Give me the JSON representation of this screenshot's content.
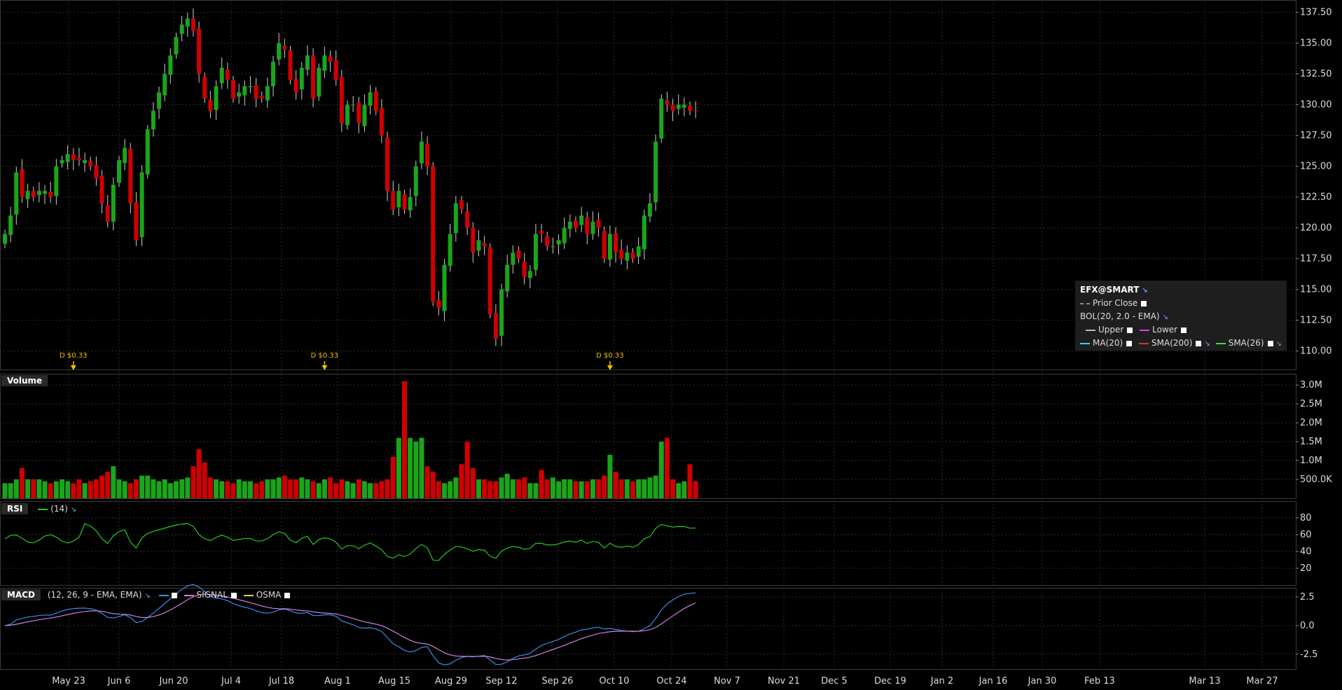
{
  "legend": {
    "symbol": "EFX@SMART",
    "prior_close": "Prior Close",
    "bol": "BOL(20, 2.0 - EMA)",
    "upper": "Upper",
    "lower": "Lower",
    "ma20": "MA(20)",
    "sma200": "SMA(200)",
    "sma26": "SMA(26)"
  },
  "panels": {
    "volume": "Volume",
    "rsi": "RSI",
    "rsi_period": "(14)",
    "macd": "MACD",
    "macd_params": "(12, 26, 9 - EMA, EMA)",
    "signal": "SIGNAL",
    "osma": "OSMA"
  },
  "colors": {
    "up": "#1aa51a",
    "down": "#d00000",
    "rsi": "#22c922",
    "macd": "#3a8ee6",
    "signal": "#d080e0",
    "dividend": "#f0c000",
    "grid": "#2b2b2b"
  },
  "chart_data": [
    {
      "type": "candlestick",
      "title": "EFX@SMART",
      "ylim": [
        108.5,
        138.5
      ],
      "y_ticks": [
        "137.50",
        "135.00",
        "132.50",
        "130.00",
        "127.50",
        "125.00",
        "122.50",
        "120.00",
        "117.50",
        "115.00",
        "112.50",
        "110.00"
      ],
      "x_ticks": [
        "May 23",
        "Jun 6",
        "Jun 20",
        "Jul 4",
        "Jul 18",
        "Aug 1",
        "Aug 15",
        "Aug 29",
        "Sep 12",
        "Sep 26",
        "Oct 10",
        "Oct 24",
        "Nov 7",
        "Nov 21",
        "Dec 5",
        "Dec 19",
        "Jan 2",
        "Jan 16",
        "Jan 30",
        "Feb 13",
        "Mar 13",
        "Mar 27"
      ],
      "close": [
        119.5,
        121,
        124.5,
        122.5,
        123,
        122.5,
        123,
        123,
        122.5,
        125,
        125.5,
        126,
        125.5,
        125.5,
        125.5,
        125,
        124,
        122,
        120.5,
        123.5,
        125.5,
        126.5,
        122,
        119,
        124.5,
        128,
        129.5,
        131,
        132.5,
        134,
        135.5,
        136.5,
        137,
        136,
        132.5,
        130.5,
        129.5,
        131.5,
        133,
        132,
        130.5,
        131,
        131.5,
        131.5,
        130.5,
        130.5,
        131.5,
        133.5,
        135,
        134.5,
        132,
        131,
        133,
        134,
        130.5,
        133,
        134,
        133.5,
        132,
        128.5,
        130,
        130,
        128.5,
        130,
        131,
        129.5,
        127.5,
        123,
        121.5,
        123,
        121.5,
        122.5,
        125,
        127,
        125,
        114,
        113.5,
        117,
        119.5,
        122,
        121.5,
        120,
        118,
        119,
        118.5,
        113,
        111,
        115,
        117,
        118,
        117.5,
        116,
        116.5,
        119.5,
        119.5,
        118.5,
        118.5,
        119,
        120,
        120.5,
        120,
        121,
        119.5,
        120.5,
        120,
        117.5,
        119.5,
        118,
        117.5,
        118,
        117.5,
        118.5,
        121,
        122,
        127,
        130.5,
        130,
        129.5,
        130,
        130,
        129.5,
        129.5
      ],
      "volume": [
        0.4,
        0.4,
        0.5,
        0.8,
        0.5,
        0.5,
        0.5,
        0.45,
        0.4,
        0.45,
        0.5,
        0.45,
        0.4,
        0.5,
        0.4,
        0.45,
        0.5,
        0.6,
        0.7,
        0.85,
        0.5,
        0.45,
        0.4,
        0.5,
        0.6,
        0.6,
        0.5,
        0.45,
        0.5,
        0.4,
        0.45,
        0.5,
        0.55,
        0.85,
        1.3,
        0.95,
        0.55,
        0.5,
        0.45,
        0.45,
        0.4,
        0.5,
        0.45,
        0.45,
        0.4,
        0.45,
        0.5,
        0.5,
        0.55,
        0.6,
        0.5,
        0.5,
        0.55,
        0.5,
        0.45,
        0.4,
        0.5,
        0.55,
        0.4,
        0.5,
        0.45,
        0.4,
        0.5,
        0.45,
        0.4,
        0.4,
        0.45,
        0.5,
        1.1,
        1.6,
        3.1,
        1.6,
        1.5,
        1.6,
        0.85,
        0.7,
        0.45,
        0.4,
        0.45,
        0.55,
        0.9,
        1.5,
        0.8,
        0.5,
        0.5,
        0.45,
        0.45,
        0.55,
        0.65,
        0.5,
        0.5,
        0.55,
        0.4,
        0.4,
        0.75,
        0.5,
        0.55,
        0.45,
        0.5,
        0.5,
        0.45,
        0.45,
        0.45,
        0.5,
        0.5,
        0.6,
        1.15,
        0.7,
        0.5,
        0.5,
        0.45,
        0.5,
        0.5,
        0.55,
        0.6,
        1.5,
        1.6,
        0.5,
        0.4,
        0.45,
        0.9,
        0.45
      ],
      "dividends": [
        {
          "label": "D $0.33",
          "index": 12
        },
        {
          "label": "D $0.33",
          "index": 56
        },
        {
          "label": "D $0.33",
          "index": 106
        }
      ]
    },
    {
      "type": "bar",
      "title": "Volume",
      "ylim": [
        0,
        3.3
      ],
      "y_ticks": [
        "3.0M",
        "2.5M",
        "2.0M",
        "1.5M",
        "1.0M",
        "500.0K"
      ]
    },
    {
      "type": "line",
      "title": "RSI",
      "ylim": [
        0,
        100
      ],
      "y_ticks": [
        "80",
        "60",
        "40",
        "20"
      ]
    },
    {
      "type": "line",
      "title": "MACD",
      "ylim": [
        -3.8,
        3.3
      ],
      "y_ticks": [
        "2.5",
        "0.0",
        "-2.5"
      ],
      "series": [
        {
          "name": "MACD"
        },
        {
          "name": "SIGNAL"
        }
      ]
    }
  ]
}
